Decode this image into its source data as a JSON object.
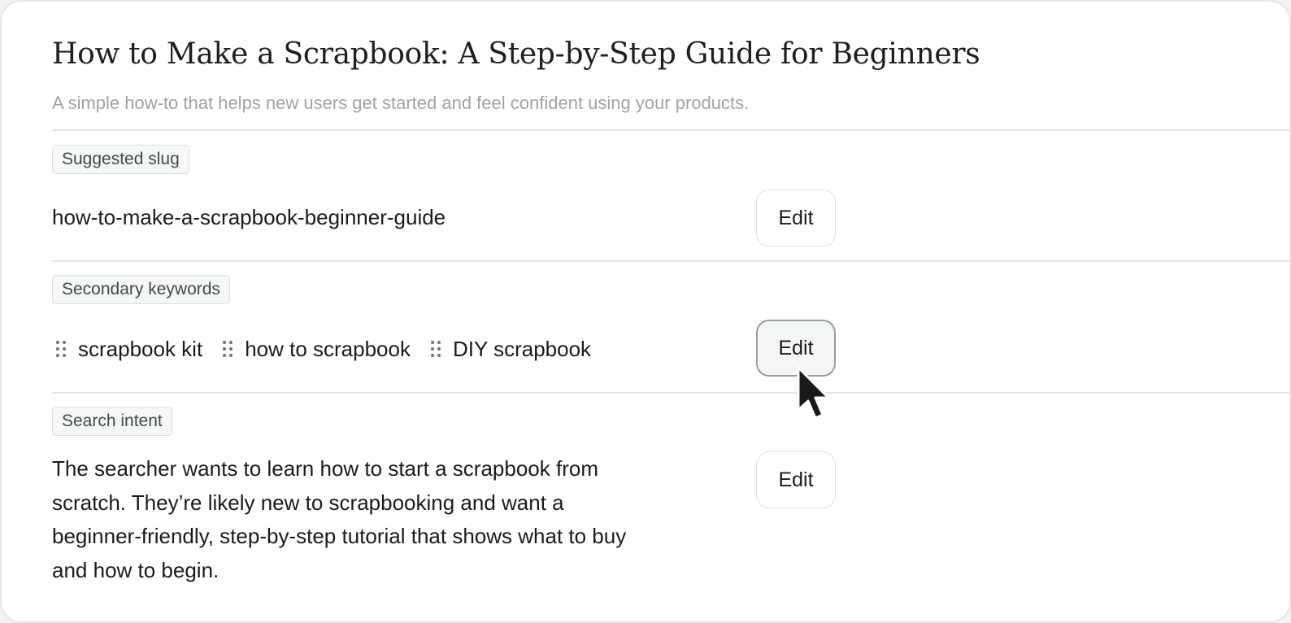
{
  "header": {
    "title": "How to Make a Scrapbook: A Step-by-Step Guide for Beginners",
    "subtitle": "A simple how-to that helps new users get started and feel confident using your products."
  },
  "slug_section": {
    "label": "Suggested slug",
    "value": "how-to-make-a-scrapbook-beginner-guide",
    "edit_label": "Edit"
  },
  "keywords_section": {
    "label": "Secondary keywords",
    "keywords": [
      "scrapbook kit",
      "how to scrapbook",
      "DIY scrapbook"
    ],
    "edit_label": "Edit"
  },
  "intent_section": {
    "label": "Search intent",
    "value": "The searcher wants to learn how to start a scrapbook from scratch. They’re likely new to scrapbooking and want a beginner-friendly, step-by-step tutorial that shows what to buy and how to begin.",
    "edit_label": "Edit"
  },
  "icons": {
    "drag_handle": "drag-handle-icon",
    "cursor": "mouse-pointer-icon"
  },
  "colors": {
    "chip_background": "#f6f7f7",
    "chip_border": "#dcdedf",
    "chip_text": "#3e4a4c",
    "subtitle_text": "#a3a3a3",
    "divider": "#e4e4e4",
    "hover_button_border": "#9a9d9e"
  }
}
